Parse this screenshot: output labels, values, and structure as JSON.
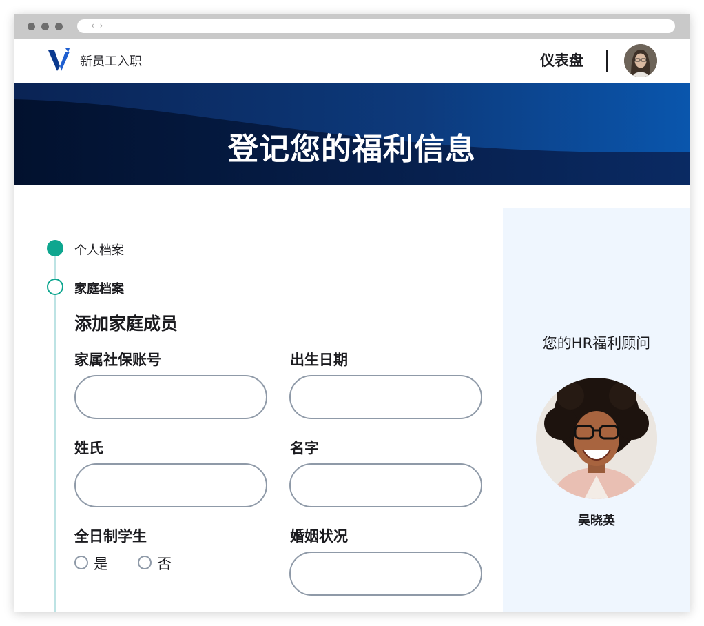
{
  "browser": {
    "nav_arrows": "‹ ›"
  },
  "header": {
    "brand": "新员工入职",
    "dashboard": "仪表盘",
    "logo_icon": "v-logo-icon",
    "avatar_icon": "user-avatar"
  },
  "hero": {
    "title": "登记您的福利信息"
  },
  "steps": [
    {
      "label": "个人档案",
      "status": "completed"
    },
    {
      "label": "家庭档案",
      "status": "current"
    }
  ],
  "form": {
    "section_title": "添加家庭成员",
    "fields": {
      "ssn": {
        "label": "家属社保账号",
        "value": ""
      },
      "dob": {
        "label": "出生日期",
        "value": ""
      },
      "last_name": {
        "label": "姓氏",
        "value": ""
      },
      "first_name": {
        "label": "名字",
        "value": ""
      },
      "marital": {
        "label": "婚姻状况",
        "value": ""
      }
    },
    "fulltime_student": {
      "label": "全日制学生",
      "options": [
        "是",
        "否"
      ],
      "selected": null
    }
  },
  "advisor": {
    "title": "您的HR福利顾问",
    "name": "吴晓英"
  },
  "colors": {
    "accent_teal": "#0ea68f",
    "hero_navy": "#0b2a5c",
    "side_panel_bg": "#eff6fe",
    "input_border": "#8f9aa8"
  }
}
